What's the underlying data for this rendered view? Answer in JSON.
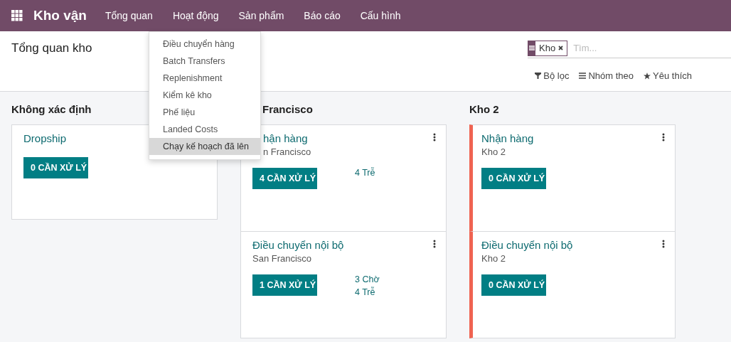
{
  "navbar": {
    "app_name": "Kho vận",
    "menus": [
      {
        "label": "Tổng quan"
      },
      {
        "label": "Hoạt động"
      },
      {
        "label": "Sản phẩm"
      },
      {
        "label": "Báo cáo"
      },
      {
        "label": "Cấu hình"
      }
    ]
  },
  "dropdown": {
    "items": [
      {
        "label": "Điều chuyển hàng",
        "selected": false
      },
      {
        "label": "Batch Transfers",
        "selected": false
      },
      {
        "label": "Replenishment",
        "selected": false
      },
      {
        "label": "Kiểm kê kho",
        "selected": false
      },
      {
        "label": "Phế liệu",
        "selected": false
      },
      {
        "label": "Landed Costs",
        "selected": false
      },
      {
        "label": "Chạy kế hoạch đã lên",
        "selected": true
      }
    ]
  },
  "breadcrumb": "Tổng quan kho",
  "search": {
    "facet": "Kho",
    "placeholder": "Tìm...",
    "filters": [
      {
        "kind": "filter",
        "label": "Bộ lọc"
      },
      {
        "kind": "group",
        "label": "Nhóm theo"
      },
      {
        "kind": "favorite",
        "label": "Yêu thích"
      }
    ]
  },
  "columns": [
    {
      "title": "Không xác định",
      "covered": false,
      "cards": [
        {
          "title": "Dropship",
          "covered": false,
          "button": "0 CẦN XỬ LÝ"
        }
      ]
    },
    {
      "title": "Francisco",
      "covered": true,
      "cards": [
        {
          "title": "hận hàng",
          "covered": true,
          "subtitle": "n Francisco",
          "button": "4 CẦN XỬ LÝ",
          "stats": [
            "4 Trễ"
          ],
          "menu": true
        },
        {
          "title": "Điều chuyển nội bộ",
          "covered": false,
          "subtitle": "San Francisco",
          "button": "1 CẦN XỬ LÝ",
          "stats": [
            "3 Chờ",
            "4 Trễ"
          ],
          "menu": true
        }
      ]
    },
    {
      "title": "Kho 2",
      "covered": false,
      "cards": [
        {
          "title": "Nhận hàng",
          "covered": false,
          "subtitle": "Kho 2",
          "button": "0 CẦN XỬ LÝ",
          "menu": true,
          "color": "#ef6351"
        },
        {
          "title": "Điều chuyển nội bộ",
          "covered": false,
          "subtitle": "Kho 2",
          "button": "0 CẦN XỬ LÝ",
          "menu": true,
          "color": "#ef6351"
        }
      ]
    }
  ]
}
